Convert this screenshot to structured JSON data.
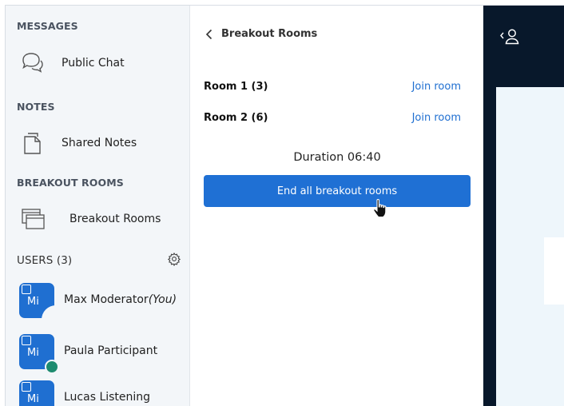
{
  "sidebar": {
    "messages_header": "MESSAGES",
    "public_chat_label": "Public Chat",
    "notes_header": "NOTES",
    "shared_notes_label": "Shared Notes",
    "breakout_header": "BREAKOUT ROOMS",
    "breakout_label": "Breakout Rooms",
    "users_header": "USERS (3)",
    "users": [
      {
        "initials": "Mi",
        "name": "Max Moderator",
        "suffix": "(You)",
        "status": "none"
      },
      {
        "initials": "Mi",
        "name": "Paula Participant",
        "suffix": "",
        "status": "headset"
      },
      {
        "initials": "Mi",
        "name": "Lucas Listening",
        "suffix": "",
        "status": "none"
      }
    ]
  },
  "panel": {
    "back_label": "Breakout Rooms",
    "rooms": [
      {
        "name": "Room 1 (3)",
        "action": "Join room"
      },
      {
        "name": "Room 2 (6)",
        "action": "Join room"
      }
    ],
    "duration": "Duration 06:40",
    "end_button": "End all breakout rooms"
  },
  "colors": {
    "accent": "#1f70d4",
    "sidebar_bg": "#f3f6f9",
    "dark_bg": "#08182b",
    "headset_status": "#1d8b6f"
  },
  "icons": [
    "chat-bubbles-icon",
    "notes-icon",
    "breakout-window-icon",
    "gear-icon",
    "chevron-left-icon",
    "user-icon",
    "hand-cursor-icon",
    "presenter-icon",
    "headset-icon"
  ]
}
